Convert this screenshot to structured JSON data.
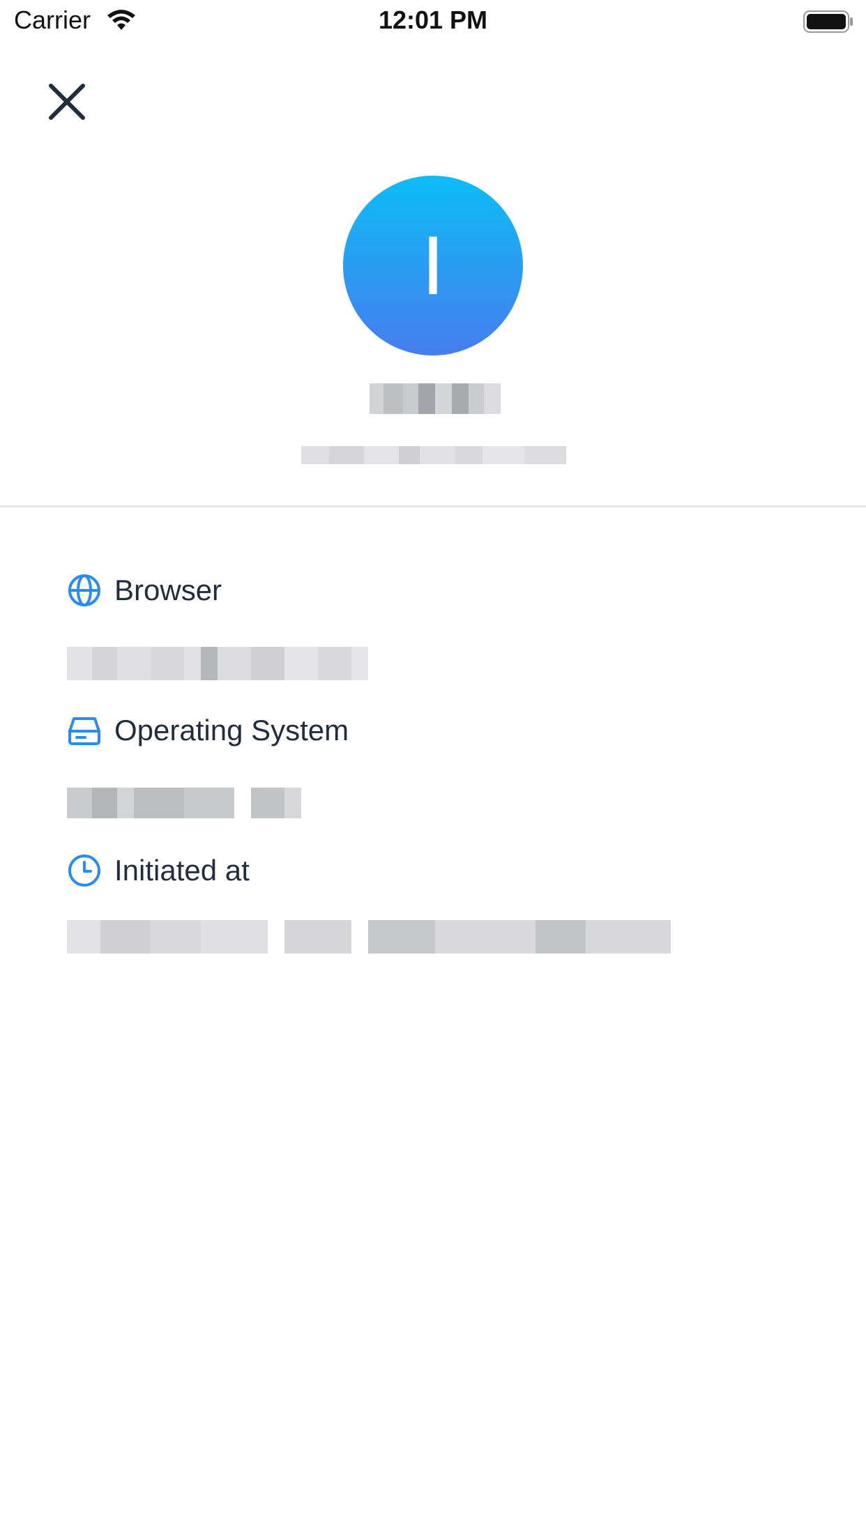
{
  "status_bar": {
    "carrier": "Carrier",
    "time": "12:01 PM"
  },
  "header": {
    "close_icon": "close-icon"
  },
  "profile": {
    "avatar_initial": "I",
    "avatar_gradient": [
      "#0cbdf7",
      "#477ded"
    ]
  },
  "details": {
    "browser_label": "Browser",
    "os_label": "Operating System",
    "initiated_label": "Initiated at",
    "icon_color": "#2b8cef"
  }
}
